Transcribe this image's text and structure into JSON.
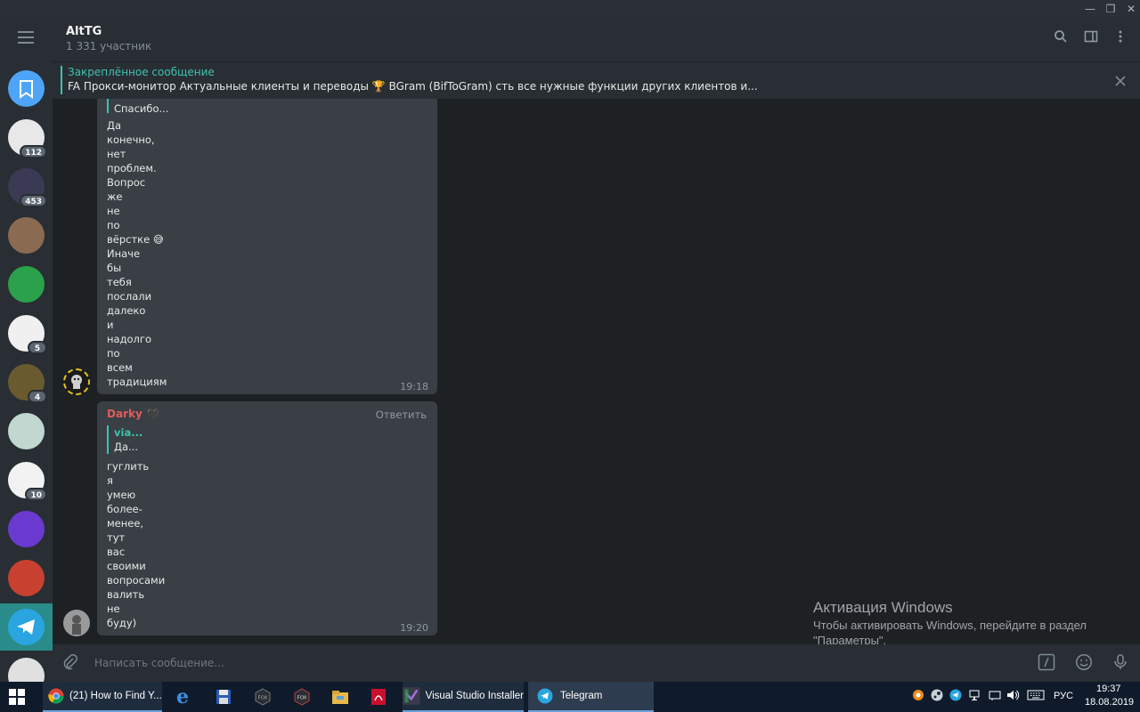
{
  "window": {
    "minimize_glyph": "—",
    "restore_glyph": "❐",
    "close_glyph": "✕"
  },
  "sidebar": {
    "items": [
      {
        "name": "saved-messages",
        "color": "#4ea4f6",
        "badge": ""
      },
      {
        "name": "chat-1",
        "color": "#e8e8e8",
        "badge": "112"
      },
      {
        "name": "chat-2",
        "color": "#3a3a55",
        "badge": "453"
      },
      {
        "name": "chat-3",
        "color": "#8a6a50",
        "badge": ""
      },
      {
        "name": "chat-4",
        "color": "#2aa14a",
        "badge": ""
      },
      {
        "name": "chat-5",
        "color": "#f0f0f0",
        "badge": "5"
      },
      {
        "name": "chat-6",
        "color": "#6a5a30",
        "badge": "4"
      },
      {
        "name": "chat-7",
        "color": "#c0d8d0",
        "badge": ""
      },
      {
        "name": "chat-8",
        "color": "#f2f2f2",
        "badge": "10"
      },
      {
        "name": "chat-9",
        "color": "#6a3ad0",
        "badge": ""
      },
      {
        "name": "chat-10",
        "color": "#c84030",
        "badge": ""
      },
      {
        "name": "chat-11",
        "color": "#2aa5e0",
        "badge": ""
      },
      {
        "name": "chat-12",
        "color": "#e0e0e0",
        "badge": ""
      }
    ]
  },
  "header": {
    "title": "AltTG",
    "subtitle": "1 331 участник"
  },
  "pinned": {
    "title": "Закреплённое сообщение",
    "text": "FA    Прокси-монитор   Актуальные клиенты и переводы  🏆 BGram (BifToGram)    сть все нужные функции других клиентов и..."
  },
  "messages": [
    {
      "quote": "Спасибо...",
      "lines": [
        "Да",
        "конечно,",
        "нет",
        "проблем.",
        "Вопрос",
        "же",
        "не",
        "по",
        "вёрстке 😅",
        "Иначе",
        "бы",
        "тебя",
        "послали",
        "далеко",
        "и",
        "надолго",
        "по",
        "всем",
        "традициям"
      ],
      "time": "19:18"
    },
    {
      "author": "Darky 🖤",
      "reply_label": "Ответить",
      "quote_author": "via...",
      "quote": "Да...",
      "lines": [
        "гуглить",
        "я",
        "умею",
        "более-",
        "менее,",
        "тут",
        "вас",
        "своими",
        "вопросами",
        "валить",
        "не",
        "буду)"
      ],
      "time": "19:20"
    }
  ],
  "activation": {
    "title": "Активация Windows",
    "line1": "Чтобы активировать Windows, перейдите в раздел",
    "line2": "\"Параметры\"."
  },
  "composer": {
    "placeholder": "Написать сообщение..."
  },
  "taskbar": {
    "chrome_label": "(21) How to Find Y...",
    "vs_label": "Visual Studio Installer",
    "telegram_label": "Telegram",
    "lang": "РУС",
    "time": "19:37",
    "date": "18.08.2019"
  }
}
